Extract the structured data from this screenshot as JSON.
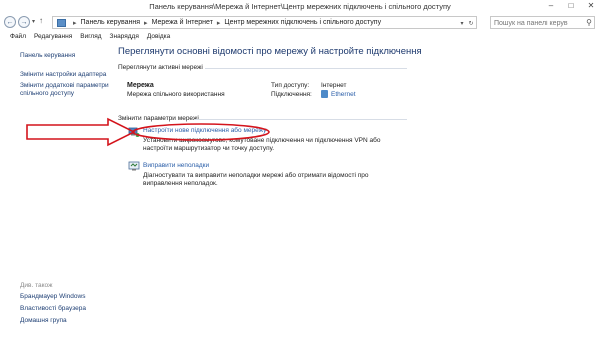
{
  "window": {
    "title": "Панель керування\\Мережа й Інтернет\\Центр мережних підключень і спільного доступу"
  },
  "address": {
    "crumbs": [
      "Панель керування",
      "Мережа й Інтернет",
      "Центр мережних підключень і спільного доступу"
    ]
  },
  "search": {
    "placeholder": "Пошук на панелі керув"
  },
  "menu": [
    "Файл",
    "Редагування",
    "Вигляд",
    "Знаряддя",
    "Довідка"
  ],
  "sidebar": {
    "home": "Панель керування",
    "links": [
      "Змінити настройки адаптера",
      "Змінити додаткові параметри спільного доступу"
    ],
    "see_also": "Див. також",
    "bottom_links": [
      "Брандмауер Windows",
      "Властивості браузера",
      "Домашня група"
    ]
  },
  "main": {
    "heading": "Переглянути основні відомості про мережу й настройте підключення",
    "active_label": "Переглянути активні мережі",
    "network": {
      "name": "Мережа",
      "type": "Мережа спільного використання",
      "access_key": "Тип доступу:",
      "access_value": "Інтернет",
      "connections_key": "Підключення:",
      "connections_value": "Ethernet"
    },
    "change_label": "Змінити параметри мережі",
    "tasks": [
      {
        "link": "Настроїти нове підключення або мережу",
        "desc": "Установити широкосмугове, комутоване підключення чи підключення VPN або настроїти маршрутизатор чи точку доступу."
      },
      {
        "link": "Виправити неполадки",
        "desc": "Діагностувати та виправити неполадки мережі або отримати відомості про виправлення неполадок."
      }
    ]
  },
  "annotation": {
    "color": "#d4141c"
  }
}
